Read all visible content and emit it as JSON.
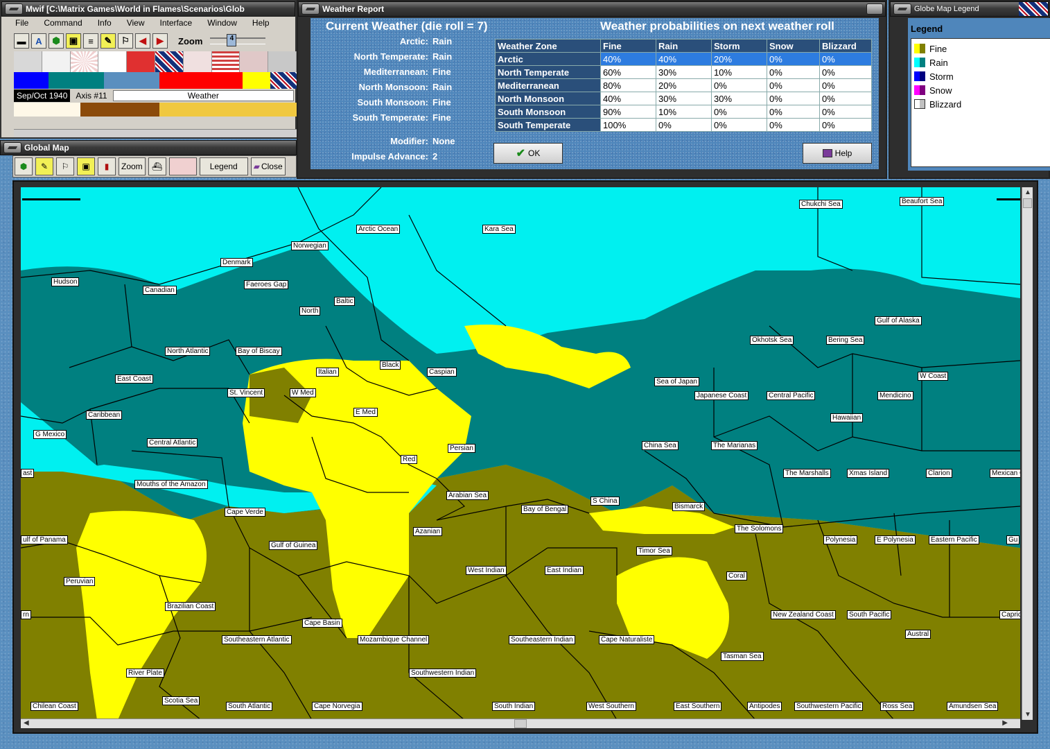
{
  "main_window": {
    "title": "Mwif [C:\\Matrix Games\\World in Flames\\Scenarios\\Glob",
    "menu": [
      "File",
      "Command",
      "Info",
      "View",
      "Interface",
      "Window",
      "Help"
    ],
    "zoom_label": "Zoom",
    "zoom_value": "4",
    "date": "Sep/Oct 1940",
    "turn": "Axis #11",
    "weather_label": "Weather"
  },
  "global_map": {
    "title": "Global Map",
    "zoom_button": "Zoom",
    "legend_button": "Legend",
    "close_button": "Close"
  },
  "weather_report": {
    "title": "Weather Report",
    "current_heading": "Current Weather (die roll = 7)",
    "prob_heading": "Weather probabilities on next weather roll",
    "zones": [
      {
        "label": "Arctic:",
        "value": "Rain"
      },
      {
        "label": "North Temperate:",
        "value": "Rain"
      },
      {
        "label": "Mediterranean:",
        "value": "Fine"
      },
      {
        "label": "North Monsoon:",
        "value": "Rain"
      },
      {
        "label": "South Monsoon:",
        "value": "Fine"
      },
      {
        "label": "South Temperate:",
        "value": "Fine"
      }
    ],
    "modifier_label": "Modifier:",
    "modifier_value": "None",
    "impulse_label": "Impulse Advance:",
    "impulse_value": "2",
    "table_headers": [
      "Weather Zone",
      "Fine",
      "Rain",
      "Storm",
      "Snow",
      "Blizzard"
    ],
    "table_rows": [
      [
        "Arctic",
        "40%",
        "40%",
        "20%",
        "0%",
        "0%"
      ],
      [
        "North Temperate",
        "60%",
        "30%",
        "10%",
        "0%",
        "0%"
      ],
      [
        "Mediterranean",
        "80%",
        "20%",
        "0%",
        "0%",
        "0%"
      ],
      [
        "North Monsoon",
        "40%",
        "30%",
        "30%",
        "0%",
        "0%"
      ],
      [
        "South Monsoon",
        "90%",
        "10%",
        "0%",
        "0%",
        "0%"
      ],
      [
        "South Temperate",
        "100%",
        "0%",
        "0%",
        "0%",
        "0%"
      ]
    ],
    "ok_button": "OK",
    "help_button": "Help"
  },
  "legend": {
    "window_title": "Globe Map Legend",
    "title": "Legend",
    "items": [
      {
        "label": "Fine",
        "color1": "#ffff00",
        "color2": "#808000"
      },
      {
        "label": "Rain",
        "color1": "#00ffff",
        "color2": "#008080"
      },
      {
        "label": "Storm",
        "color1": "#0000ff",
        "color2": "#000080"
      },
      {
        "label": "Snow",
        "color1": "#ff00ff",
        "color2": "#800080"
      },
      {
        "label": "Blizzard",
        "color1": "#ffffff",
        "color2": "#c0c0c0"
      }
    ]
  },
  "map_labels": [
    "Chukchi Sea",
    "Beaufort Sea",
    "Arctic Ocean",
    "Kara Sea",
    "Norwegian",
    "Denmark",
    "Hudson",
    "Faeroes Gap",
    "Canadian",
    "Baltic",
    "North",
    "Gulf of Alaska",
    "North Atlantic",
    "Bay of Biscay",
    "Okhotsk Sea",
    "Bering Sea",
    "East Coast",
    "Black",
    "Italian",
    "Caspian",
    "Sea of Japan",
    "W Coast",
    "St. Vincent",
    "W Med",
    "Japanese Coast",
    "Central Pacific",
    "Mendicino",
    "Caribbean",
    "E Med",
    "Hawaiian",
    "G Mexico",
    "Central Atlantic",
    "Persian",
    "China Sea",
    "The Marianas",
    "Red",
    "The Marshalls",
    "Xmas Island",
    "Clarion",
    "Mexican Coa",
    "Mouths of the Amazon",
    "Arabian Sea",
    "S China",
    "Bismarck",
    "Cape Verde",
    "Bay of Bengal",
    "The Solomons",
    "Azanian",
    "ulf of Panama",
    "Gulf of Guinea",
    "Polynesia",
    "E Polynesia",
    "Eastern Pacific",
    "Gu",
    "Timor Sea",
    "West Indian",
    "East Indian",
    "Coral",
    "Peruvian",
    "Brazilian Coast",
    "New Zealand Coast",
    "South Pacific",
    "Capricor",
    "Cape Basin",
    "Austral",
    "Southeastern Atlantic",
    "Mozambique Channel",
    "Southeastern Indian",
    "Cape Naturaliste",
    "Tasman Sea",
    "River Plate",
    "Southwestern Indian",
    "Scotia Sea",
    "Chilean Coast",
    "South Atlantic",
    "Cape Norvegia",
    "South Indian",
    "West Southern",
    "East Southern",
    "Antipodes",
    "Southwestern Pacific",
    "Ross Sea",
    "Amundsen Sea",
    "ast",
    "rn"
  ]
}
